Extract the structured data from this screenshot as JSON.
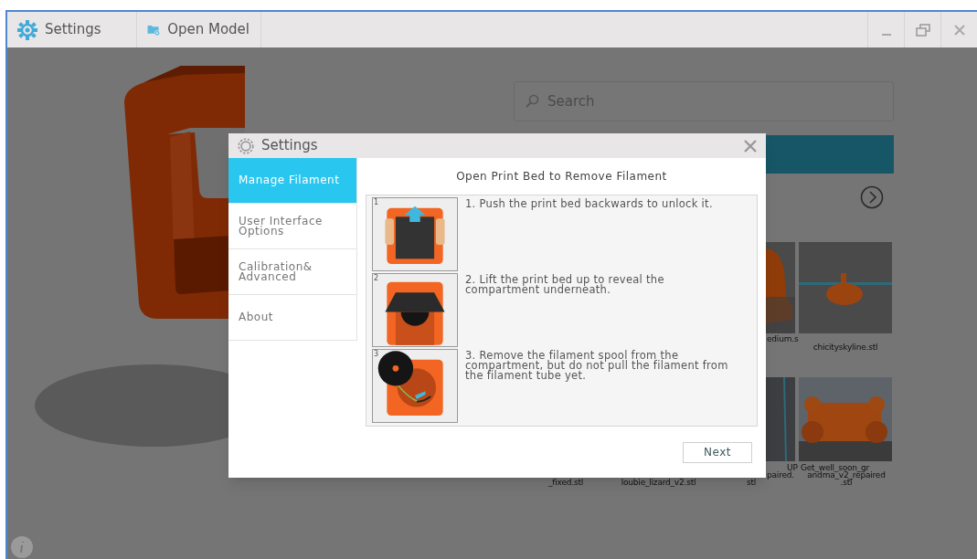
{
  "titlebar": {
    "items": [
      {
        "kind": "settings",
        "label": "Settings"
      },
      {
        "kind": "open",
        "label": "Open Model"
      }
    ]
  },
  "search": {
    "placeholder": "Search"
  },
  "gallery": {
    "labels": [
      "edium.s",
      "chicityskyline.stl",
      "UP",
      "Get_well_soon_gr",
      "paired.",
      "andma_v2_repaired",
      "_fixed.stl",
      "loubie_lizard_v2.stl",
      "stl",
      ".stl"
    ]
  },
  "dialog": {
    "title": "Settings",
    "sidebar": [
      {
        "label": "Manage Filament",
        "selected": true
      },
      {
        "label": "User Interface Options",
        "selected": false
      },
      {
        "label": "Calibration& Advanced",
        "selected": false
      },
      {
        "label": "About",
        "selected": false
      }
    ],
    "heading": "Open Print Bed to Remove Filament",
    "steps": [
      {
        "number": "1",
        "kind": "push",
        "text": "1. Push the print bed backwards to unlock it."
      },
      {
        "number": "2",
        "kind": "lift",
        "text": "2. Lift the print bed up to reveal the compartment underneath."
      },
      {
        "number": "3",
        "kind": "spool",
        "text": "3. Remove the filament spool from the compartment, but do not pull the filament from the filament tube yet."
      }
    ],
    "button": "Next"
  }
}
